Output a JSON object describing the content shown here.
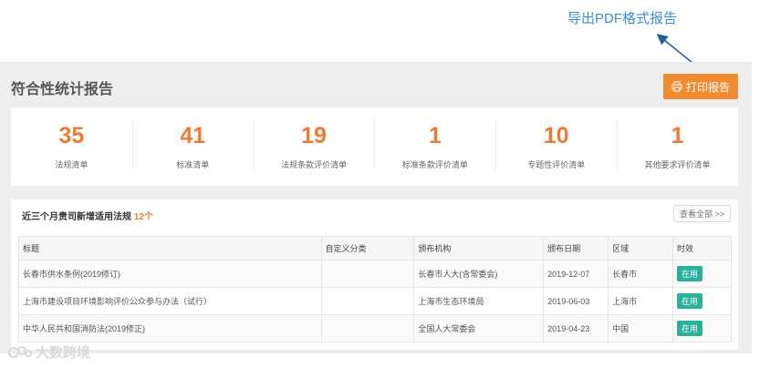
{
  "callout": {
    "text": "导出PDF格式报告"
  },
  "report": {
    "title": "符合性统计报告",
    "print_label": "打印报告"
  },
  "stats": [
    {
      "value": "35",
      "label": "法规清单"
    },
    {
      "value": "41",
      "label": "标准清单"
    },
    {
      "value": "19",
      "label": "法规条款评价清单"
    },
    {
      "value": "1",
      "label": "标准条款评价清单"
    },
    {
      "value": "10",
      "label": "专题性评价清单"
    },
    {
      "value": "1",
      "label": "其他要求评价清单"
    }
  ],
  "laws": {
    "heading_prefix": "近三个月贵司新增适用法规",
    "count": "12个",
    "view_all": "查看全部 >>",
    "columns": [
      "标题",
      "自定义分类",
      "颁布机构",
      "颁布日期",
      "区域",
      "时效"
    ],
    "rows": [
      {
        "title": "长春市供水条例(2019修订)",
        "category": "",
        "issuer": "长春市人大(含常委会)",
        "date": "2019-12-07",
        "region": "长春市",
        "status": "在用"
      },
      {
        "title": "上海市建设项目环境影响评价公众参与办法（试行）",
        "category": "",
        "issuer": "上海市生态环境局",
        "date": "2019-06-03",
        "region": "上海市",
        "status": "在用"
      },
      {
        "title": "中华人民共和国消防法(2019修正)",
        "category": "",
        "issuer": "全国人大常委会",
        "date": "2019-04-23",
        "region": "中国",
        "status": "在用"
      }
    ]
  },
  "watermark": {
    "text": "大数跨境"
  },
  "colors": {
    "accent": "#f07a32",
    "button": "#f08c30",
    "status_tag": "#2bb09b",
    "callout": "#3a8fd0"
  }
}
